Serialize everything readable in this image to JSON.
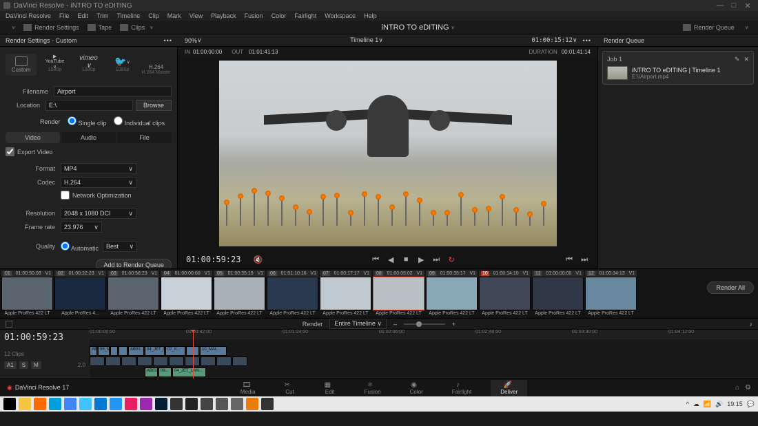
{
  "titlebar": {
    "app": "DaVinci Resolve",
    "project": "iNTRO TO eDITING"
  },
  "menubar": [
    "DaVinci Resolve",
    "File",
    "Edit",
    "Trim",
    "Timeline",
    "Clip",
    "Mark",
    "View",
    "Playback",
    "Fusion",
    "Color",
    "Fairlight",
    "Workspace",
    "Help"
  ],
  "toolbar": {
    "render_settings": "Render Settings",
    "tape": "Tape",
    "clips": "Clips",
    "title": "iNTRO TO eDITING",
    "render_queue": "Render Queue"
  },
  "subheader": {
    "left_title": "Render Settings - Custom",
    "zoom": "90%",
    "timeline": "Timeline 1",
    "duration": "01:00:15:12",
    "right_title": "Render Queue"
  },
  "tcrow": {
    "in_lbl": "IN",
    "in": "01:00:00:00",
    "out_lbl": "OUT",
    "out": "01:01:41:13",
    "dur_lbl": "DURATION",
    "dur": "00:01:41:14"
  },
  "settings": {
    "presets": [
      {
        "label": "Custom",
        "sub": ""
      },
      {
        "label": "YouTube",
        "sub": "1080p"
      },
      {
        "label": "vimeo",
        "sub": "1080p"
      },
      {
        "label": "Twitter",
        "sub": "1080p"
      },
      {
        "label": "H.264",
        "sub": "H.264 Master"
      }
    ],
    "filename_lbl": "Filename",
    "filename": "Airport",
    "location_lbl": "Location",
    "location": "E:\\",
    "browse": "Browse",
    "render_lbl": "Render",
    "single": "Single clip",
    "individual": "Individual clips",
    "tabs": [
      "Video",
      "Audio",
      "File"
    ],
    "export_video": "Export Video",
    "format_lbl": "Format",
    "format": "MP4",
    "codec_lbl": "Codec",
    "codec": "H.264",
    "netopt": "Network Optimization",
    "resolution_lbl": "Resolution",
    "resolution": "2048 x 1080 DCI",
    "framerate_lbl": "Frame rate",
    "framerate": "23.976",
    "quality_lbl": "Quality",
    "quality_auto": "Automatic",
    "quality_best": "Best",
    "add_queue": "Add to Render Queue"
  },
  "transport": {
    "tc": "01:00:59:23"
  },
  "queue": {
    "job_label": "Job 1",
    "job_title": "iNTRO TO eDITING | Timeline 1",
    "job_path": "E:\\\\Airport.mp4",
    "render_all": "Render All"
  },
  "clips": [
    {
      "n": "01",
      "tc": "01:00:50:08",
      "tr": "V1",
      "codec": "Apple ProRes 422 LT"
    },
    {
      "n": "02",
      "tc": "01:00:22:23",
      "tr": "V1",
      "codec": "Apple ProRes 4..."
    },
    {
      "n": "03",
      "tc": "01:00:58:23",
      "tr": "V1",
      "codec": "Apple ProRes 422 LT"
    },
    {
      "n": "04",
      "tc": "01:00:00:00",
      "tr": "V1",
      "codec": "Apple ProRes 422 LT"
    },
    {
      "n": "05",
      "tc": "01:00:35:19",
      "tr": "V1",
      "codec": "Apple ProRes 422 LT"
    },
    {
      "n": "06",
      "tc": "01:01:10:16",
      "tr": "V1",
      "codec": "Apple ProRes 422 LT"
    },
    {
      "n": "07",
      "tc": "01:00:17:17",
      "tr": "V1",
      "codec": "Apple ProRes 422 LT"
    },
    {
      "n": "08",
      "tc": "01:00:05:02",
      "tr": "V1",
      "codec": "Apple ProRes 422 LT",
      "sel": true
    },
    {
      "n": "09",
      "tc": "01:00:35:17",
      "tr": "V1",
      "codec": "Apple ProRes 422 LT"
    },
    {
      "n": "10",
      "tc": "01:00:14:10",
      "tr": "V1",
      "codec": "Apple ProRes 422 LT",
      "red": true
    },
    {
      "n": "11",
      "tc": "01:00:00:00",
      "tr": "V1",
      "codec": "Apple ProRes 422 LT"
    },
    {
      "n": "12",
      "tc": "01:00:34:13",
      "tr": "V1",
      "codec": "Apple ProRes 422 LT"
    }
  ],
  "tlctrl": {
    "render": "Render",
    "scope": "Entire Timeline"
  },
  "timeline": {
    "tc": "01:00:59:23",
    "clips_count": "12 Clips",
    "a1": "A1",
    "s": "S",
    "m": "M",
    "gain": "2.0",
    "ticks": [
      "01:00:00:00",
      "01:00:42:00",
      "01:01:24:00",
      "01:02:06:00",
      "01:02:48:00",
      "01:03:30:00",
      "01:04:12:00"
    ],
    "v_segs": [
      "AB...",
      "06_MI...",
      "",
      "",
      "AB01...",
      "04_JET_LAN...",
      "07_K...",
      "",
      "10_MAL..."
    ],
    "a_segs": [
      "AB01...",
      "09...",
      "04_JET_LAN..."
    ]
  },
  "pages": {
    "brand": "DaVinci Resolve 17",
    "tabs": [
      "Media",
      "Cut",
      "Edit",
      "Fusion",
      "Color",
      "Fairlight",
      "Deliver"
    ],
    "active": 6
  },
  "tray": {
    "time": "19:15"
  }
}
